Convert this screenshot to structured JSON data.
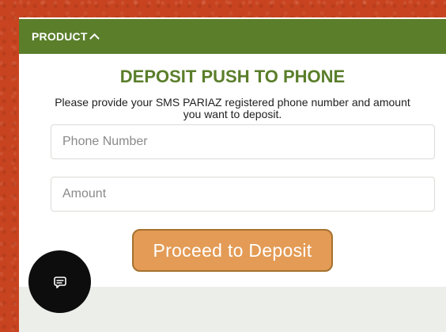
{
  "product_bar": {
    "label": "PRODUCT",
    "toggle_icon": "chevron-up-icon"
  },
  "deposit": {
    "title": "DEPOSIT PUSH TO PHONE",
    "description": "Please provide your SMS PARIAZ registered phone number and amount you want to deposit.",
    "phone_field": {
      "placeholder": "Phone Number",
      "value": ""
    },
    "amount_field": {
      "placeholder": "Amount",
      "value": ""
    },
    "submit_label": "Proceed to Deposit"
  },
  "chat_widget": {
    "icon": "chat-bubble-icon"
  },
  "colors": {
    "page_background": "#c8431f",
    "header_green": "#5a7e2a",
    "button_orange": "#e39b55",
    "button_border": "#a5722f",
    "chat_fab": "#0d0d0d"
  }
}
